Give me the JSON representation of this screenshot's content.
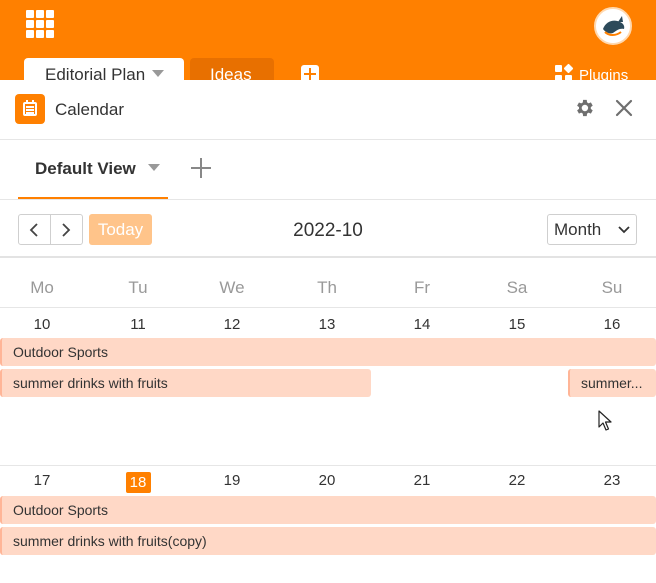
{
  "app": {
    "tabs": [
      {
        "label": "Editorial Plan"
      },
      {
        "label": "Ideas"
      }
    ],
    "plugins_label": "Plugins"
  },
  "panel": {
    "title": "Calendar",
    "view_tab": "Default View"
  },
  "toolbar": {
    "today_label": "Today",
    "month_label": "2022-10",
    "view_mode": "Month"
  },
  "weekdays": [
    "Mo",
    "Tu",
    "We",
    "Th",
    "Fr",
    "Sa",
    "Su"
  ],
  "weeks": [
    {
      "days": [
        "10",
        "11",
        "12",
        "13",
        "14",
        "15",
        "16"
      ],
      "events": [
        {
          "title": "Outdoor Sports"
        },
        {
          "title": "summer drinks with fruits"
        },
        {
          "title": "summer..."
        }
      ]
    },
    {
      "days": [
        "17",
        "18",
        "19",
        "20",
        "21",
        "22",
        "23"
      ],
      "today": "18",
      "events": [
        {
          "title": "Outdoor Sports"
        },
        {
          "title": "summer drinks with fruits(copy)"
        }
      ]
    }
  ],
  "colors": {
    "brand": "#ff8000",
    "event_bg": "#ffd8c6",
    "today_button": "#ffc48a"
  },
  "icons": {
    "apps": "grid-icon",
    "calendar": "calendar-icon",
    "settings": "gear-icon",
    "close": "close-icon",
    "prev": "chevron-left-icon",
    "next": "chevron-right-icon",
    "add": "plus-icon"
  }
}
